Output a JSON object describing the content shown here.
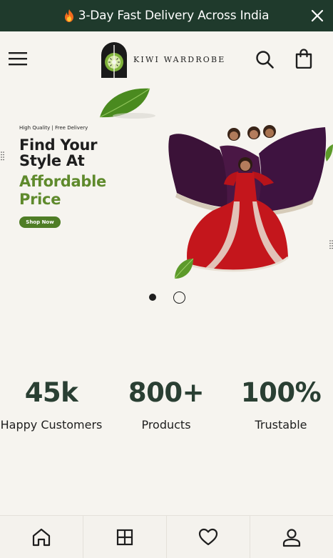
{
  "announcement": {
    "text": "3-Day Fast Delivery Across India",
    "icon": "flame-icon",
    "close_icon": "close-icon"
  },
  "header": {
    "menu_icon": "hamburger-menu-icon",
    "logo_text": "KIWI WARDROBE",
    "search_icon": "search-icon",
    "bag_icon": "shopping-bag-icon"
  },
  "hero": {
    "tagline": "High Quality | Free Delivery",
    "heading_line1": "Find Your",
    "heading_line2": "Style At",
    "heading_accent_line1": "Affordable",
    "heading_accent_line2": "Price",
    "cta_label": "Shop Now",
    "slides_total": 2,
    "active_slide": 1,
    "accent_color": "#5f8a2c"
  },
  "stats": [
    {
      "value": "45k",
      "label": "Happy Customers"
    },
    {
      "value": "800+",
      "label": "Products"
    },
    {
      "value": "100%",
      "label": "Trustable"
    }
  ],
  "bottom_nav": [
    {
      "icon": "home-icon"
    },
    {
      "icon": "grid-icon"
    },
    {
      "icon": "heart-icon"
    },
    {
      "icon": "user-icon"
    }
  ],
  "colors": {
    "announcement_bg": "#1f3a2c",
    "page_bg": "#f6f4ef",
    "stat_number": "#2a3f33",
    "cta_bg": "#4f7d26"
  }
}
